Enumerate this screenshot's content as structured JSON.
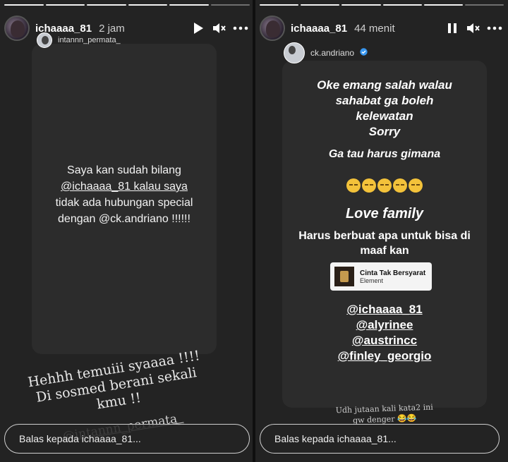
{
  "left": {
    "progress": [
      true,
      true,
      true,
      true,
      true,
      false
    ],
    "username": "ichaaaa_81",
    "time": "2 jam",
    "mention_chip": "intannn_permata_",
    "story_text": {
      "line1": "Saya kan sudah bilang",
      "line2": "@ichaaaa_81 kalau saya",
      "line3": "tidak ada hubungan special",
      "line4": "dengan @ck.andriano !!!!!!"
    },
    "scrawl": {
      "line1": "Hehhh temuiii syaaaa !!!!",
      "line2": "Di sosmed berani sekali",
      "line3": "kmu !!",
      "mention": "@intannn_permata_"
    },
    "reply_placeholder": "Balas kepada ichaaaa_81..."
  },
  "right": {
    "progress": [
      true,
      true,
      true,
      true,
      true,
      false
    ],
    "username": "ichaaaa_81",
    "time": "44 menit",
    "mention_chip": "ck.andriano",
    "story_lines": [
      "Oke emang salah walau",
      "sahabat ga boleh",
      "kelewatan",
      "Sorry"
    ],
    "line_ga_tau": "Ga tau harus gimana",
    "love": "Love family",
    "harus_lines": [
      "Harus berbuat apa untuk bisa di",
      "maaf kan"
    ],
    "music": {
      "title": "Cinta Tak Bersyarat",
      "artist": "Element"
    },
    "tags": [
      "@ichaaaa_81",
      "@alyrinee",
      "@austrincc",
      "@finley_georgio"
    ],
    "footnote": [
      "Udh jutaan kali kata2 ini",
      "gw denger 😂😂"
    ],
    "reply_placeholder": "Balas kepada ichaaaa_81..."
  },
  "colors": {
    "background": "#232323",
    "card": "#2c2c2c",
    "verified": "#3897f0"
  },
  "icons": [
    "play-icon",
    "mute-icon",
    "more-icon",
    "pause-icon",
    "verified-icon"
  ]
}
